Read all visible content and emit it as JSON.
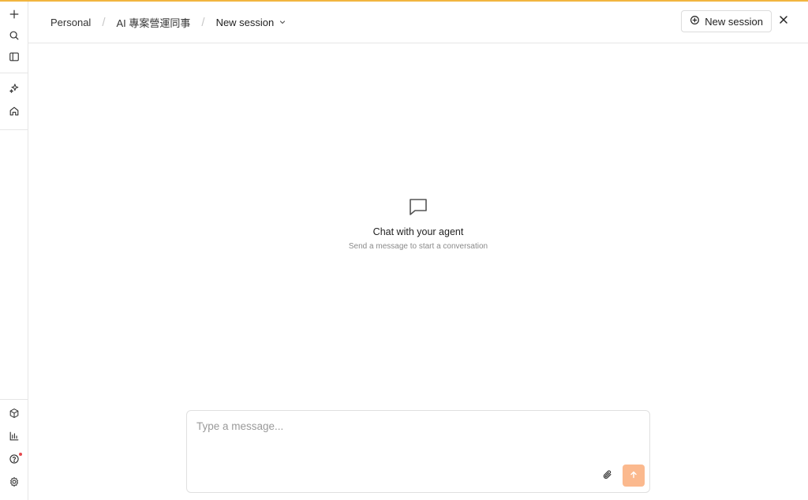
{
  "colors": {
    "accent_line": "#f2b53f",
    "send_button": "#fbb98e",
    "notification_dot": "#e5484d",
    "border": "#e6e6e6"
  },
  "rail": {
    "top_items": [
      {
        "name": "plus-icon",
        "label": "New"
      },
      {
        "name": "search-icon",
        "label": "Search"
      },
      {
        "name": "sidebar-toggle-icon",
        "label": "Toggle sidebar"
      }
    ],
    "middle_items": [
      {
        "name": "sparkles-icon",
        "label": "AI"
      },
      {
        "name": "home-icon",
        "label": "Home"
      }
    ],
    "bottom_items": [
      {
        "name": "package-icon",
        "label": "Packages"
      },
      {
        "name": "bar-chart-icon",
        "label": "Analytics"
      },
      {
        "name": "help-icon",
        "label": "Help",
        "has_notification": true
      },
      {
        "name": "settings-icon",
        "label": "Settings"
      }
    ]
  },
  "breadcrumb": {
    "workspace": "Personal",
    "agent": "AI 專案營運同事",
    "session": "New session"
  },
  "header": {
    "new_session_label": "New session"
  },
  "empty_state": {
    "title": "Chat with your agent",
    "subtitle": "Send a message to start a conversation"
  },
  "composer": {
    "placeholder": "Type a message...",
    "value": ""
  }
}
